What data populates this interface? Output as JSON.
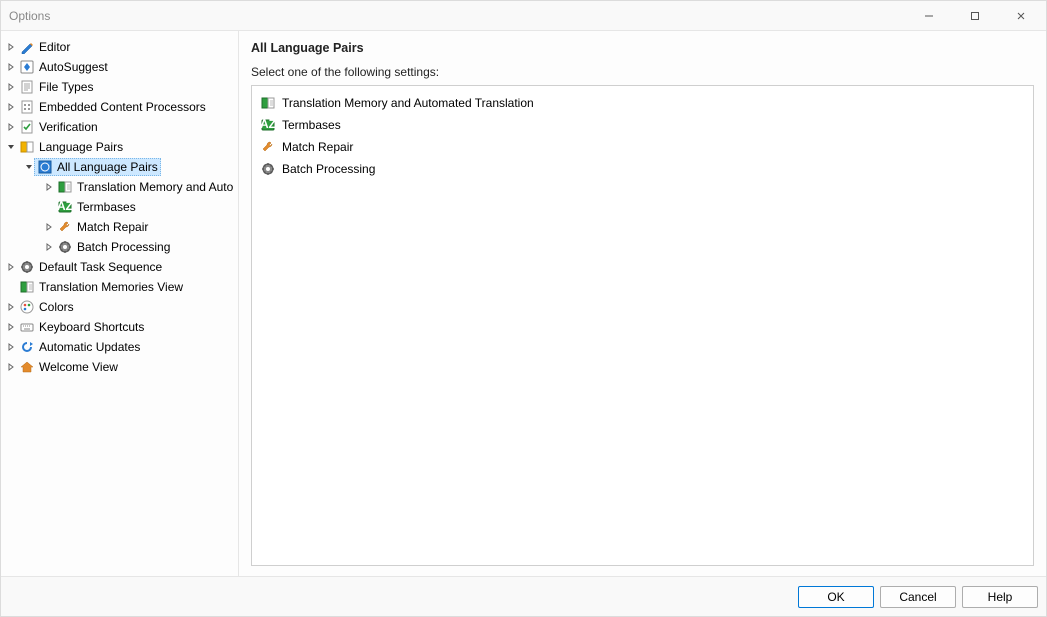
{
  "window": {
    "title": "Options"
  },
  "sidebar": {
    "items": [
      {
        "label": "Editor",
        "icon": "pencil"
      },
      {
        "label": "AutoSuggest",
        "icon": "diamond"
      },
      {
        "label": "File Types",
        "icon": "page"
      },
      {
        "label": "Embedded Content Processors",
        "icon": "page-dots"
      },
      {
        "label": "Verification",
        "icon": "check-page"
      },
      {
        "label": "Language Pairs",
        "icon": "lang"
      },
      {
        "label": "All Language Pairs",
        "icon": "all-lang"
      },
      {
        "label": "Translation Memory and Auto",
        "icon": "tm"
      },
      {
        "label": "Termbases",
        "icon": "term"
      },
      {
        "label": "Match Repair",
        "icon": "wrench"
      },
      {
        "label": "Batch Processing",
        "icon": "gear"
      },
      {
        "label": "Default Task Sequence",
        "icon": "gear"
      },
      {
        "label": "Translation Memories View",
        "icon": "tm"
      },
      {
        "label": "Colors",
        "icon": "palette"
      },
      {
        "label": "Keyboard Shortcuts",
        "icon": "keyboard"
      },
      {
        "label": "Automatic Updates",
        "icon": "updates"
      },
      {
        "label": "Welcome View",
        "icon": "home"
      }
    ]
  },
  "main": {
    "header": "All Language Pairs",
    "subheader": "Select one of the following settings:",
    "settings": [
      {
        "label": "Translation Memory and Automated Translation",
        "icon": "tm"
      },
      {
        "label": "Termbases",
        "icon": "term"
      },
      {
        "label": "Match Repair",
        "icon": "wrench"
      },
      {
        "label": "Batch Processing",
        "icon": "gear"
      }
    ]
  },
  "footer": {
    "ok": "OK",
    "cancel": "Cancel",
    "help": "Help"
  }
}
